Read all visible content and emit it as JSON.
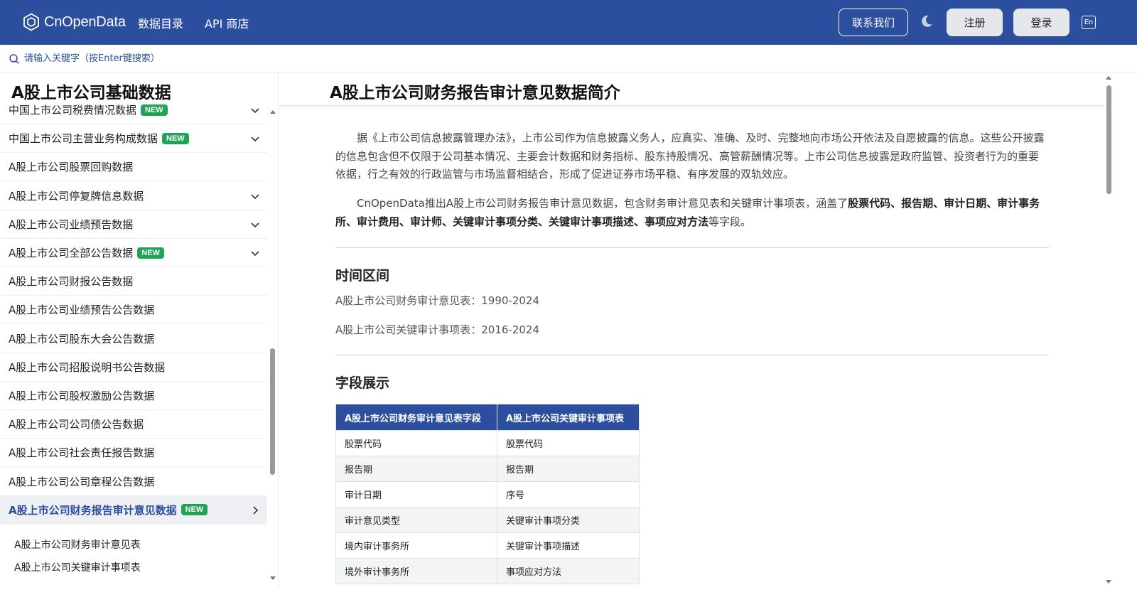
{
  "header": {
    "logo_text": "CnOpenData",
    "nav": [
      "数据目录",
      "API 商店"
    ],
    "contact_label": "联系我们",
    "register_label": "注册",
    "login_label": "登录",
    "lang_label": "En",
    "brand_color": "#2b4f9e"
  },
  "search": {
    "placeholder": "请输入关键字（按Enter键搜索）"
  },
  "sidebar": {
    "title": "A股上市公司基础数据",
    "items": [
      {
        "label": "中国上市公司税费情况数据",
        "badge": "NEW",
        "chevron": "down"
      },
      {
        "label": "中国上市公司主营业务构成数据",
        "badge": "NEW",
        "chevron": "down"
      },
      {
        "label": "A股上市公司股票回购数据",
        "badge": "",
        "chevron": ""
      },
      {
        "label": "A股上市公司停复牌信息数据",
        "badge": "",
        "chevron": "down"
      },
      {
        "label": "A股上市公司业绩预告数据",
        "badge": "",
        "chevron": "down"
      },
      {
        "label": "A股上市公司全部公告数据",
        "badge": "NEW",
        "chevron": "down"
      },
      {
        "label": "A股上市公司财报公告数据",
        "badge": "",
        "chevron": ""
      },
      {
        "label": "A股上市公司业绩预告公告数据",
        "badge": "",
        "chevron": ""
      },
      {
        "label": "A股上市公司股东大会公告数据",
        "badge": "",
        "chevron": ""
      },
      {
        "label": "A股上市公司招股说明书公告数据",
        "badge": "",
        "chevron": ""
      },
      {
        "label": "A股上市公司股权激励公告数据",
        "badge": "",
        "chevron": ""
      },
      {
        "label": "A股上市公司公司债公告数据",
        "badge": "",
        "chevron": ""
      },
      {
        "label": "A股上市公司社会责任报告数据",
        "badge": "",
        "chevron": ""
      },
      {
        "label": "A股上市公司公司章程公告数据",
        "badge": "",
        "chevron": ""
      },
      {
        "label": "A股上市公司财务报告审计意见数据",
        "badge": "NEW",
        "chevron": "right",
        "active": true
      }
    ],
    "sub_items": [
      "A股上市公司财务审计意见表",
      "A股上市公司关键审计事项表"
    ]
  },
  "main": {
    "title": "A股上市公司财务报告审计意见数据简介",
    "para1": "据《上市公司信息披露管理办法》，上市公司作为信息披露义务人，应真实、准确、及时、完整地向市场公开依法及自愿披露的信息。这些公开披露的信息包含但不仅限于公司基本情况、主要会计数据和财务指标、股东持股情况、高管薪酬情况等。上市公司信息披露是政府监管、投资者行为的重要依据，行之有效的行政监管与市场监督相结合，形成了促进证券市场平稳、有序发展的双轨效应。",
    "para2_prefix": "CnOpenData推出A股上市公司财务报告审计意见数据，包含财务审计意见表和关键审计事项表，涵盖了",
    "para2_bold": "股票代码、报告期、审计日期、审计事务所、审计费用、审计师、关键审计事项分类、关键审计事项描述、事项应对方法",
    "para2_suffix": "等字段。",
    "time_title": "时间区间",
    "time_ranges": [
      "A股上市公司财务审计意见表：1990-2024",
      "A股上市公司关键审计事项表：2016-2024"
    ],
    "fields_title": "字段展示",
    "table": {
      "headers": [
        "A股上市公司财务审计意见表字段",
        "A股上市公司关键审计事项表"
      ],
      "rows": [
        [
          "股票代码",
          "股票代码"
        ],
        [
          "报告期",
          "报告期"
        ],
        [
          "审计日期",
          "序号"
        ],
        [
          "审计意见类型",
          "关键审计事项分类"
        ],
        [
          "境内审计事务所",
          "关键审计事项描述"
        ],
        [
          "境外审计事务所",
          "事项应对方法"
        ]
      ]
    }
  }
}
